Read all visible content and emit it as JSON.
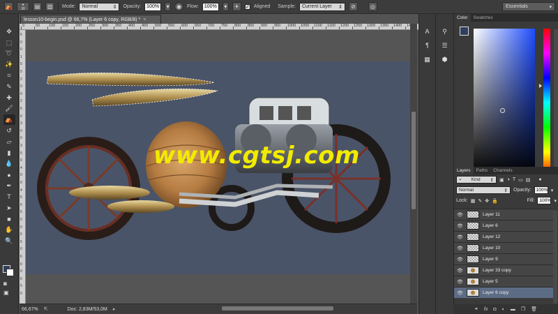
{
  "options_bar": {
    "brush_size": "30",
    "mode_label": "Mode:",
    "mode_value": "Normal",
    "opacity_label": "Opacity:",
    "opacity_value": "100%",
    "flow_label": "Flow:",
    "flow_value": "100%",
    "aligned_label": "Aligned",
    "aligned_checked": "✓",
    "sample_label": "Sample:",
    "sample_value": "Current Layer"
  },
  "workspace": {
    "value": "Essentials"
  },
  "document": {
    "tab_title": "lesson10-begin.psd @ 66,7% (Layer 6 copy, RGB/8) *",
    "close_glyph": "×",
    "watermark": "www.cgtsj.com"
  },
  "ruler": {
    "top_labels": [
      "0",
      "50",
      "100",
      "150",
      "200",
      "250",
      "300",
      "350",
      "400",
      "450",
      "500",
      "550",
      "600",
      "650",
      "700",
      "750",
      "800",
      "850",
      "900",
      "950",
      "1000",
      "1050",
      "1100",
      "1150",
      "1200",
      "1250",
      "1300",
      "1350",
      "1400",
      "1450"
    ],
    "left_labels": [
      "5",
      "0",
      "0",
      "1",
      "5",
      "0",
      "2",
      "0",
      "0",
      "2",
      "5",
      "0",
      "3",
      "0",
      "0",
      "3",
      "5",
      "0",
      "4",
      "0",
      "0",
      "4",
      "5",
      "0",
      "5",
      "0",
      "0",
      "5",
      "5",
      "0",
      "6",
      "0",
      "0",
      "6",
      "5",
      "0"
    ]
  },
  "status": {
    "zoom": "66,67%",
    "doc_info": "Doc: 2,83M/53,0M"
  },
  "color_panel": {
    "tabs": [
      "Color",
      "Swatches"
    ],
    "fg_color": "#2f3f5d",
    "bg_color": "#ffffff"
  },
  "layers_panel": {
    "tabs": [
      "Layers",
      "Paths",
      "Channels"
    ],
    "kind_value": "Kind",
    "blend_value": "Normal",
    "opacity_label": "Opacity:",
    "opacity_value": "100%",
    "lock_label": "Lock:",
    "fill_label": "Fill:",
    "fill_value": "100%",
    "layers": [
      {
        "name": "Layer 11",
        "thumb": "transparent"
      },
      {
        "name": "Layer 6",
        "thumb": "transparent"
      },
      {
        "name": "Layer 12",
        "thumb": "transparent"
      },
      {
        "name": "Layer 10",
        "thumb": "transparent"
      },
      {
        "name": "Layer 9",
        "thumb": "transparent"
      },
      {
        "name": "Layer 33 copy",
        "thumb": "image"
      },
      {
        "name": "Layer 5",
        "thumb": "image"
      },
      {
        "name": "Layer 6 copy",
        "thumb": "image",
        "selected": true
      }
    ],
    "footer_icons": [
      "link-icon",
      "fx-icon",
      "mask-icon",
      "adjustment-icon",
      "folder-icon",
      "new-layer-icon",
      "trash-icon"
    ]
  },
  "colors": {
    "canvas_bg": "#4a5468",
    "watermark": "#f1eb00",
    "selected_layer": "#5d6c85"
  }
}
